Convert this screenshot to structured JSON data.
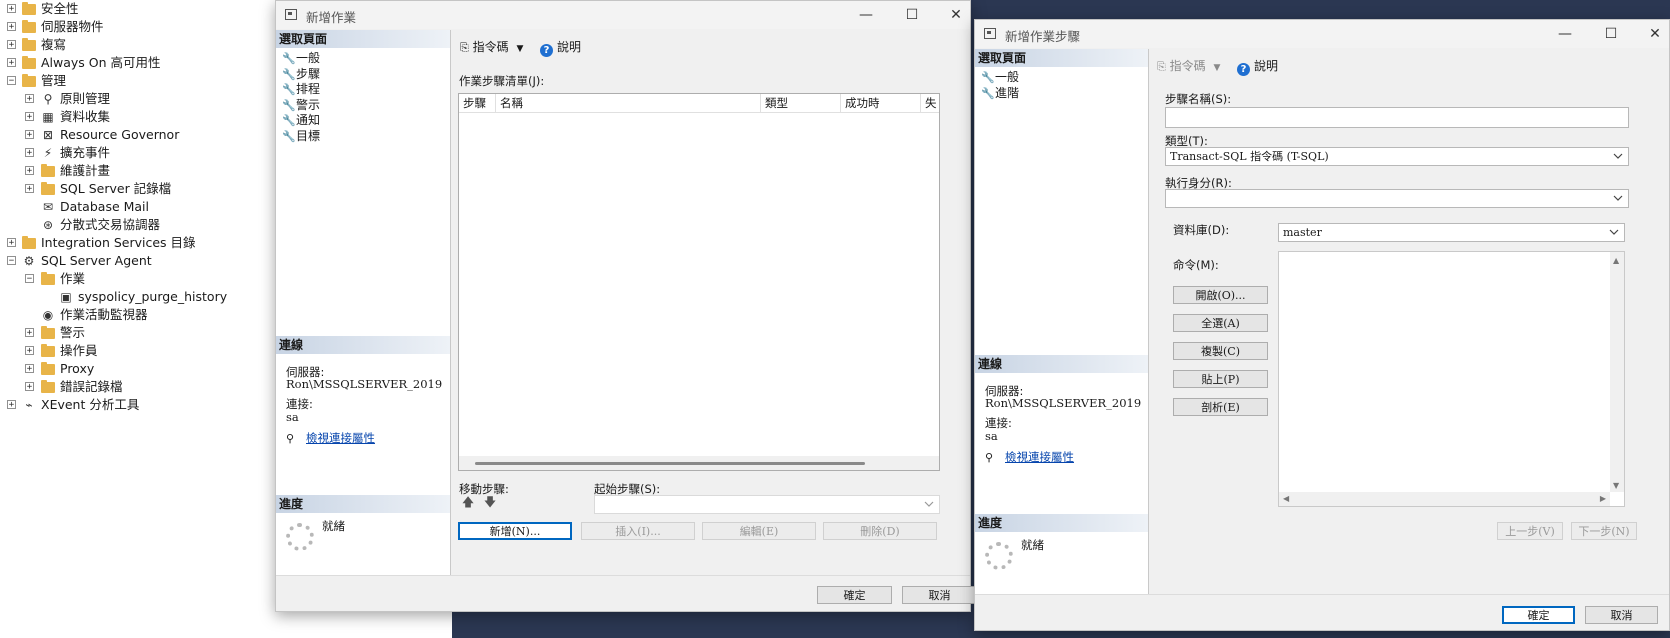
{
  "object_explorer": {
    "items": [
      {
        "label": "安全性",
        "level": 0,
        "expander": "+",
        "icon": "folder-icon"
      },
      {
        "label": "伺服器物件",
        "level": 0,
        "expander": "+",
        "icon": "folder-icon"
      },
      {
        "label": "複寫",
        "level": 0,
        "expander": "+",
        "icon": "folder-icon"
      },
      {
        "label": "Always On 高可用性",
        "level": 0,
        "expander": "+",
        "icon": "folder-icon"
      },
      {
        "label": "管理",
        "level": 0,
        "expander": "−",
        "icon": "folder-icon"
      },
      {
        "label": "原則管理",
        "level": 1,
        "expander": "+",
        "icon": "policy-icon"
      },
      {
        "label": "資料收集",
        "level": 1,
        "expander": "+",
        "icon": "data-collection-icon"
      },
      {
        "label": "Resource Governor",
        "level": 1,
        "expander": "+",
        "icon": "resource-governor-icon"
      },
      {
        "label": "擴充事件",
        "level": 1,
        "expander": "+",
        "icon": "extended-events-icon"
      },
      {
        "label": "維護計畫",
        "level": 1,
        "expander": "+",
        "icon": "folder-icon"
      },
      {
        "label": "SQL Server 記錄檔",
        "level": 1,
        "expander": "+",
        "icon": "folder-icon"
      },
      {
        "label": "Database Mail",
        "level": 1,
        "expander": "",
        "icon": "mail-icon"
      },
      {
        "label": "分散式交易協調器",
        "level": 1,
        "expander": "",
        "icon": "dtc-icon"
      },
      {
        "label": "Integration Services 目錄",
        "level": 0,
        "expander": "+",
        "icon": "folder-icon"
      },
      {
        "label": "SQL Server Agent",
        "level": 0,
        "expander": "−",
        "icon": "agent-icon"
      },
      {
        "label": "作業",
        "level": 1,
        "expander": "−",
        "icon": "folder-icon"
      },
      {
        "label": "syspolicy_purge_history",
        "level": 2,
        "expander": "",
        "icon": "job-icon"
      },
      {
        "label": "作業活動監視器",
        "level": 1,
        "expander": "",
        "icon": "monitor-icon"
      },
      {
        "label": "警示",
        "level": 1,
        "expander": "+",
        "icon": "folder-icon"
      },
      {
        "label": "操作員",
        "level": 1,
        "expander": "+",
        "icon": "folder-icon"
      },
      {
        "label": "Proxy",
        "level": 1,
        "expander": "+",
        "icon": "folder-icon"
      },
      {
        "label": "錯誤記錄檔",
        "level": 1,
        "expander": "+",
        "icon": "folder-icon"
      },
      {
        "label": "XEvent 分析工具",
        "level": 0,
        "expander": "+",
        "icon": "xevent-icon"
      }
    ]
  },
  "job_dialog": {
    "title": "新增作業",
    "select_page_header": "選取頁面",
    "pages": [
      "一般",
      "步驟",
      "排程",
      "警示",
      "通知",
      "目標"
    ],
    "toolbar": {
      "script": "指令碼",
      "help": "說明"
    },
    "steps_list_label": "作業步驟清單(J):",
    "columns": [
      "步驟",
      "名稱",
      "類型",
      "成功時",
      "失敗"
    ],
    "connection_header": "連線",
    "server_label": "伺服器:",
    "server_value": "Ron\\MSSQLSERVER_2019",
    "connection_label": "連接:",
    "connection_value": "sa",
    "view_connection_link": "檢視連接屬性",
    "progress_header": "進度",
    "progress_status": "就緒",
    "move_step_label": "移動步驟:",
    "start_step_label": "起始步驟(S):",
    "buttons": {
      "new": "新增(N)...",
      "insert": "插入(I)...",
      "edit": "編輯(E)",
      "delete": "刪除(D)"
    },
    "ok": "確定",
    "cancel": "取消"
  },
  "step_dialog": {
    "title": "新增作業步驟",
    "select_page_header": "選取頁面",
    "pages": [
      "一般",
      "進階"
    ],
    "toolbar": {
      "script": "指令碼",
      "help": "說明"
    },
    "step_name_label": "步驟名稱(S):",
    "step_name_value": "",
    "type_label": "類型(T):",
    "type_value": "Transact-SQL 指令碼 (T-SQL)",
    "run_as_label": "執行身分(R):",
    "run_as_value": "",
    "database_label": "資料庫(D):",
    "database_value": "master",
    "command_label": "命令(M):",
    "side_buttons": [
      "開啟(O)...",
      "全選(A)",
      "複製(C)",
      "貼上(P)",
      "剖析(E)"
    ],
    "connection_header": "連線",
    "server_label": "伺服器:",
    "server_value": "Ron\\MSSQLSERVER_2019",
    "connection_label": "連接:",
    "connection_value": "sa",
    "view_connection_link": "檢視連接屬性",
    "progress_header": "進度",
    "progress_status": "就緒",
    "prev_step": "上一步(V)",
    "next_step": "下一步(N)",
    "ok": "確定",
    "cancel": "取消"
  },
  "colors": {
    "desktop": "#2b3752",
    "accent": "#0067c0",
    "link": "#0645ad",
    "folder": "#e8b448"
  }
}
